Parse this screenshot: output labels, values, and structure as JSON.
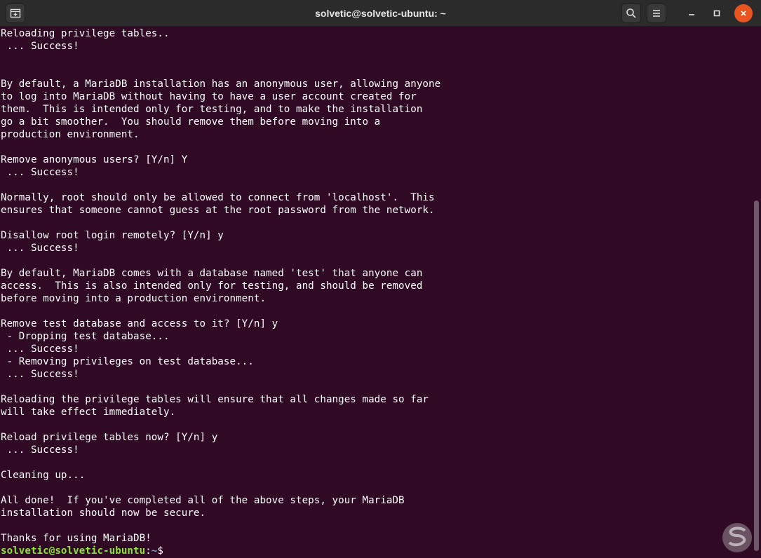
{
  "window": {
    "title": "solvetic@solvetic-ubuntu: ~"
  },
  "icons": {
    "new_tab": "new-tab-icon",
    "search": "search-icon",
    "menu": "hamburger-menu-icon",
    "minimize": "minimize-icon",
    "maximize": "maximize-icon",
    "close": "close-icon"
  },
  "colors": {
    "terminal_bg": "#300a24",
    "prompt_user": "#8ae234",
    "prompt_path": "#729fcf",
    "close_button": "#e95420"
  },
  "terminal": {
    "lines": [
      "Reloading privilege tables..",
      " ... Success!",
      "",
      "",
      "By default, a MariaDB installation has an anonymous user, allowing anyone",
      "to log into MariaDB without having to have a user account created for",
      "them.  This is intended only for testing, and to make the installation",
      "go a bit smoother.  You should remove them before moving into a",
      "production environment.",
      "",
      "Remove anonymous users? [Y/n] Y",
      " ... Success!",
      "",
      "Normally, root should only be allowed to connect from 'localhost'.  This",
      "ensures that someone cannot guess at the root password from the network.",
      "",
      "Disallow root login remotely? [Y/n] y",
      " ... Success!",
      "",
      "By default, MariaDB comes with a database named 'test' that anyone can",
      "access.  This is also intended only for testing, and should be removed",
      "before moving into a production environment.",
      "",
      "Remove test database and access to it? [Y/n] y",
      " - Dropping test database...",
      " ... Success!",
      " - Removing privileges on test database...",
      " ... Success!",
      "",
      "Reloading the privilege tables will ensure that all changes made so far",
      "will take effect immediately.",
      "",
      "Reload privilege tables now? [Y/n] y",
      " ... Success!",
      "",
      "Cleaning up...",
      "",
      "All done!  If you've completed all of the above steps, your MariaDB",
      "installation should now be secure.",
      "",
      "Thanks for using MariaDB!"
    ],
    "prompt": {
      "user_host": "solvetic@solvetic-ubuntu",
      "colon": ":",
      "path": "~",
      "symbol": "$"
    }
  }
}
